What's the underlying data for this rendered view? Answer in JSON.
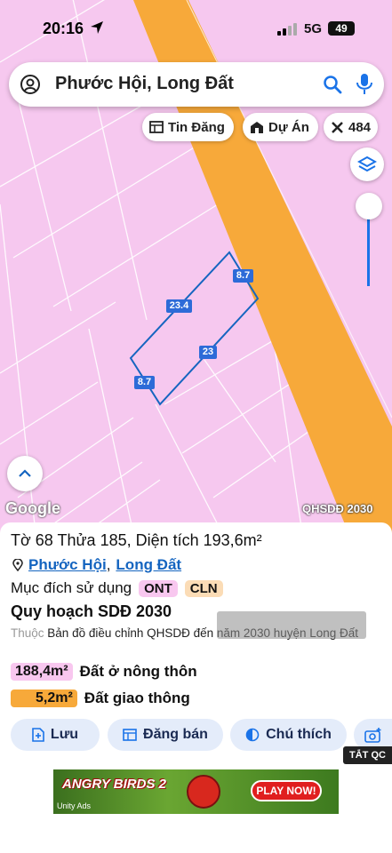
{
  "status_bar": {
    "time": "20:16",
    "network": "5G",
    "battery": "49"
  },
  "search": {
    "title": "Phước Hội, Long Đất"
  },
  "chips": {
    "listings": "Tin Đăng",
    "projects": "Dự Án",
    "count": "484"
  },
  "map": {
    "measurements": [
      "8.7",
      "23.4",
      "23",
      "8.7"
    ],
    "brand": "Google",
    "layer_label": "QHSDĐ 2030",
    "colors": {
      "land": "#f6c8ef",
      "road": "#f7a93a",
      "parcel_outline": "#1565c0"
    }
  },
  "parcel": {
    "title": "Tờ 68 Thửa 185, Diện tích 193,6m²",
    "ward": "Phước Hội",
    "separator": ",",
    "district": "Long Đất",
    "purpose_label": "Mục đích sử dụng",
    "purpose_tags": [
      "ONT",
      "CLN"
    ]
  },
  "plan": {
    "title": "Quy hoạch SDĐ 2030",
    "prefix": "Thuộc",
    "description": "Bản đồ điều chỉnh QHSDĐ đến năm 2030 huyện Long Đất",
    "areas": [
      {
        "area": "188,4m²",
        "label": "Đất ở nông thôn",
        "color": "#f8c7ef"
      },
      {
        "area": "5,2m²",
        "label": "Đất giao thông",
        "color": "#f7a93a"
      }
    ]
  },
  "actions": {
    "save": "Lưu",
    "post": "Đăng bán",
    "legend": "Chú thích"
  },
  "ad": {
    "hide_label": "TẮT QC",
    "game": "ANGRY BIRDS 2",
    "cta": "PLAY NOW!",
    "network": "Unity Ads"
  }
}
